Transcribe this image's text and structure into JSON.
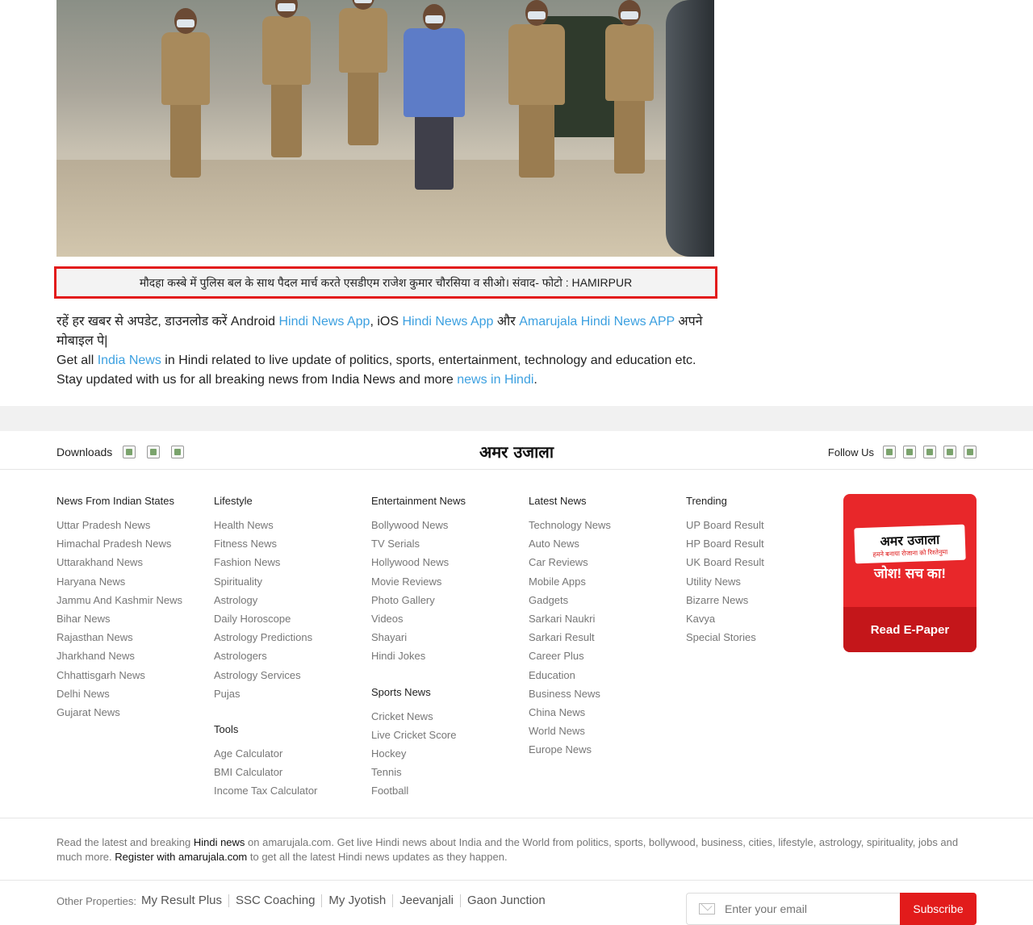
{
  "caption": "मौदहा कस्बे में पुलिस बल के साथ पैदल मार्च करते एसडीएम राजेश कुमार चौरसिया व सीओ। संवाद- फोटो : HAMIRPUR",
  "promo": {
    "line1_prefix": "रहें हर खबर से अपडेट, डाउनलोड करें Android ",
    "android_link": "Hindi News App",
    "ios_text": ", iOS ",
    "ios_link": "Hindi News App",
    "and_text": " और ",
    "amarujala_link": "Amarujala Hindi News APP",
    "line1_suffix": " अपने मोबाइल पे|",
    "line2_prefix": "Get all ",
    "india_news_link": "India News",
    "line2_mid": " in Hindi related to live update of politics, sports, entertainment, technology and education etc. Stay updated with us for all breaking news from India News and more ",
    "news_hindi_link": "news in Hindi",
    "line2_suffix": "."
  },
  "downloads_label": "Downloads",
  "logo_text": "अमर उजाला",
  "follow_label": "Follow Us",
  "columns": {
    "states": {
      "title": "News From Indian States",
      "items": [
        "Uttar Pradesh News",
        "Himachal Pradesh News",
        "Uttarakhand News",
        "Haryana News",
        "Jammu And Kashmir News",
        "Bihar News",
        "Rajasthan News",
        "Jharkhand News",
        "Chhattisgarh News",
        "Delhi News",
        "Gujarat News"
      ]
    },
    "lifestyle": {
      "title": "Lifestyle",
      "items": [
        "Health News",
        "Fitness News",
        "Fashion News",
        "Spirituality",
        "Astrology",
        "Daily Horoscope",
        "Astrology Predictions",
        "Astrologers",
        "Astrology Services",
        "Pujas"
      ]
    },
    "tools": {
      "title": "Tools",
      "items": [
        "Age Calculator",
        "BMI Calculator",
        "Income Tax Calculator"
      ]
    },
    "entertainment": {
      "title": "Entertainment News",
      "items": [
        "Bollywood News",
        "TV Serials",
        "Hollywood News",
        "Movie Reviews",
        "Photo Gallery",
        "Videos",
        "Shayari",
        "Hindi Jokes"
      ]
    },
    "sports": {
      "title": "Sports News",
      "items": [
        "Cricket News",
        "Live Cricket Score",
        "Hockey",
        "Tennis",
        "Football"
      ]
    },
    "latest": {
      "title": "Latest News",
      "items": [
        "Technology News",
        "Auto News",
        "Car Reviews",
        "Mobile Apps",
        "Gadgets",
        "Sarkari Naukri",
        "Sarkari Result",
        "Career Plus",
        "Education",
        "Business News",
        "China News",
        "World News",
        "Europe News"
      ]
    },
    "trending": {
      "title": "Trending",
      "items": [
        "UP Board Result",
        "HP Board Result",
        "UK Board Result",
        "Utility News",
        "Bizarre News",
        "Kavya",
        "Special Stories"
      ]
    }
  },
  "epaper": {
    "card_title": "अमर उजाला",
    "card_sub": "हमने बनाया रोजाना को रिश्तेनुमा",
    "tagline": "जोश! सच का!",
    "button": "Read E-Paper"
  },
  "about": {
    "p1": "Read the latest and breaking ",
    "hindi_news": "Hindi news",
    "p2": " on amarujala.com. Get live Hindi news about India and the World from politics, sports, bollywood, business, cities, lifestyle, astrology, spirituality, jobs and much more. ",
    "register": "Register with amarujala.com",
    "p3": " to get all the latest Hindi news updates as they happen."
  },
  "other_properties": {
    "label": "Other Properties:",
    "items": [
      "My Result Plus",
      "SSC Coaching",
      "My Jyotish",
      "Jeevanjali",
      "Gaon Junction"
    ]
  },
  "subscribe": {
    "placeholder": "Enter your email",
    "button": "Subscribe"
  }
}
